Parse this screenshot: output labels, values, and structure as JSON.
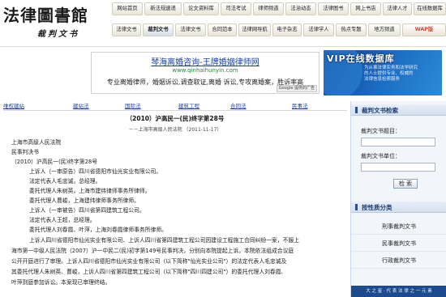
{
  "site": {
    "logo_main": "法律圖書館",
    "logo_sub": "裁判文书"
  },
  "nav": [
    {
      "label": "网站首页"
    },
    {
      "label": "新法规速递"
    },
    {
      "label": "论文资料库"
    },
    {
      "label": "司法考试"
    },
    {
      "label": "律师频道"
    },
    {
      "label": "法治动态"
    },
    {
      "label": "法律图书"
    },
    {
      "label": "网上书店"
    },
    {
      "label": "法律人才"
    },
    {
      "label": "在线数据库"
    },
    {
      "label": "法律文书"
    },
    {
      "label": "裁判文书"
    },
    {
      "label": "法律文书"
    },
    {
      "label": "合同范本"
    },
    {
      "label": "法律网导航"
    },
    {
      "label": "电子杂志"
    },
    {
      "label": "法律学人"
    },
    {
      "label": "热点专题"
    },
    {
      "label": "地方频道"
    },
    {
      "label": "WAP版"
    }
  ],
  "ad": {
    "title": "琴海离婚咨询-王牌婚姻律师网",
    "url": "www.qinhaihunyin.com",
    "desc": "专业离婚律师，婚姻诉讼,调查取证,离婚 诉讼,专攻离婚案，胜诉率高",
    "google": "Google 提供的广告"
  },
  "banner": {
    "title": "VIP在线数据库",
    "lines": [
      "为从事法律实务和法学研究",
      "的人士提供专业、权威的",
      "法律信息检索服务"
    ]
  },
  "menu": [
    "维权建站",
    "建站法",
    "国际法",
    "建筑工程",
    "合同法",
    "民事法"
  ],
  "case": {
    "title": "（2010）沪高民一(民)终字第28号",
    "court": "－－上海市高级人民法院 （2011-11-17）"
  },
  "doc": {
    "lines": [
      {
        "text": "上海市高级人民法院",
        "ind": false
      },
      {
        "text": "民事判决书",
        "ind": false
      },
      {
        "text": "（2010）沪高民一(民)终字第28号",
        "ind": false
      },
      {
        "text": "上诉人（一审原告）四川省德阳市仙光实业有限公司。",
        "ind": true
      },
      {
        "text": "法定代表人毛忠诚，总经理。",
        "ind": true
      },
      {
        "text": "委托代理人朱树英，上海市建纬律师事务所律师。",
        "ind": true
      },
      {
        "text": "委托代理人曹峻，上海建纬律师事务所律师。",
        "ind": true
      },
      {
        "text": "上诉人（一审被告）四川省第四建筑工程公司。",
        "ind": true
      },
      {
        "text": "法定代表人王超，总经理。",
        "ind": true
      },
      {
        "text": "委托代理人刘春霞、叶萍，上海刘春霞律师事务所律师。",
        "ind": true
      }
    ],
    "para": [
      "上诉人四川省德阳市仙光实业有限公司、上诉人四川省第四建筑工程公司因建设工程施工合同纠纷一案，不服上",
      "海市第一中级人民法院（2007）沪一中民二(民)初字第149号民事判决，分别向本院提起上诉。本院依法组成合议庭",
      "公开开庭进行了审理。上诉人四川省德阳市仙光实业有限公司（以下简称\"仙光实业公司\"）的法定代表人毛忠诚及",
      "其委托代理人朱树英、曹峻，上诉人四川省第四建筑工程公司（以下简称\"四川四建公司\"）的委托代理人刘春霞、",
      "叶萍到庭参加诉讼。本案现已审理终结。"
    ]
  },
  "sidebar": {
    "search_title": "裁判文书检索",
    "field1_label": "裁判文书题目：",
    "field2_label": "裁判文书单位：",
    "search_btn": "检 索",
    "cat_title": "按性质分类",
    "categories": [
      "刑事裁判文书",
      "民事裁判文书",
      "行政裁判文书"
    ],
    "footer": "大 之 星 · 代 表 法 律 之 一 元 素"
  },
  "colors": {
    "link": "#1a3f9c",
    "sidebar_accent": "#1f3d78",
    "banner": "#1c6fc4"
  }
}
